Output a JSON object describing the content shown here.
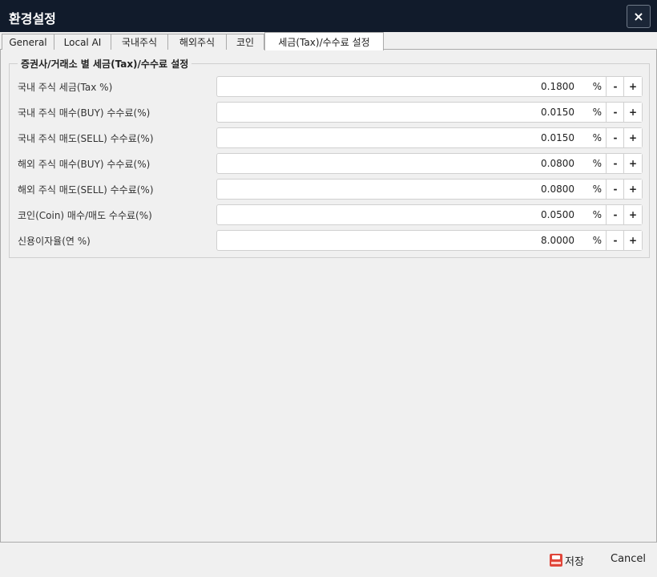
{
  "window": {
    "title": "환경설정",
    "close_label": "×"
  },
  "tabs": [
    {
      "label": "General"
    },
    {
      "label": "Local AI"
    },
    {
      "label": "국내주식"
    },
    {
      "label": "해외주식"
    },
    {
      "label": "코인"
    },
    {
      "label": "세금(Tax)/수수료 설정"
    }
  ],
  "active_tab": "세금(Tax)/수수료 설정",
  "group": {
    "title": "증권사/거래소 별 세금(Tax)/수수료 설정",
    "rows": [
      {
        "label": "국내 주식 세금(Tax %)",
        "value": "0.1800",
        "unit": "%",
        "minus": "-",
        "plus": "+"
      },
      {
        "label": "국내 주식 매수(BUY) 수수료(%)",
        "value": "0.0150",
        "unit": "%",
        "minus": "-",
        "plus": "+"
      },
      {
        "label": "국내 주식 매도(SELL) 수수료(%)",
        "value": "0.0150",
        "unit": "%",
        "minus": "-",
        "plus": "+"
      },
      {
        "label": "해외 주식 매수(BUY) 수수료(%)",
        "value": "0.0800",
        "unit": "%",
        "minus": "-",
        "plus": "+"
      },
      {
        "label": "해외 주식 매도(SELL) 수수료(%)",
        "value": "0.0800",
        "unit": "%",
        "minus": "-",
        "plus": "+"
      },
      {
        "label": "코인(Coin) 매수/매도 수수료(%)",
        "value": "0.0500",
        "unit": "%",
        "minus": "-",
        "plus": "+"
      },
      {
        "label": "신용이자율(연 %)",
        "value": "8.0000",
        "unit": "%",
        "minus": "-",
        "plus": "+"
      }
    ]
  },
  "footer": {
    "save_label": "저장",
    "save_icon_text": "SAVE",
    "save_icon": "save-icon",
    "cancel_label": "Cancel"
  }
}
